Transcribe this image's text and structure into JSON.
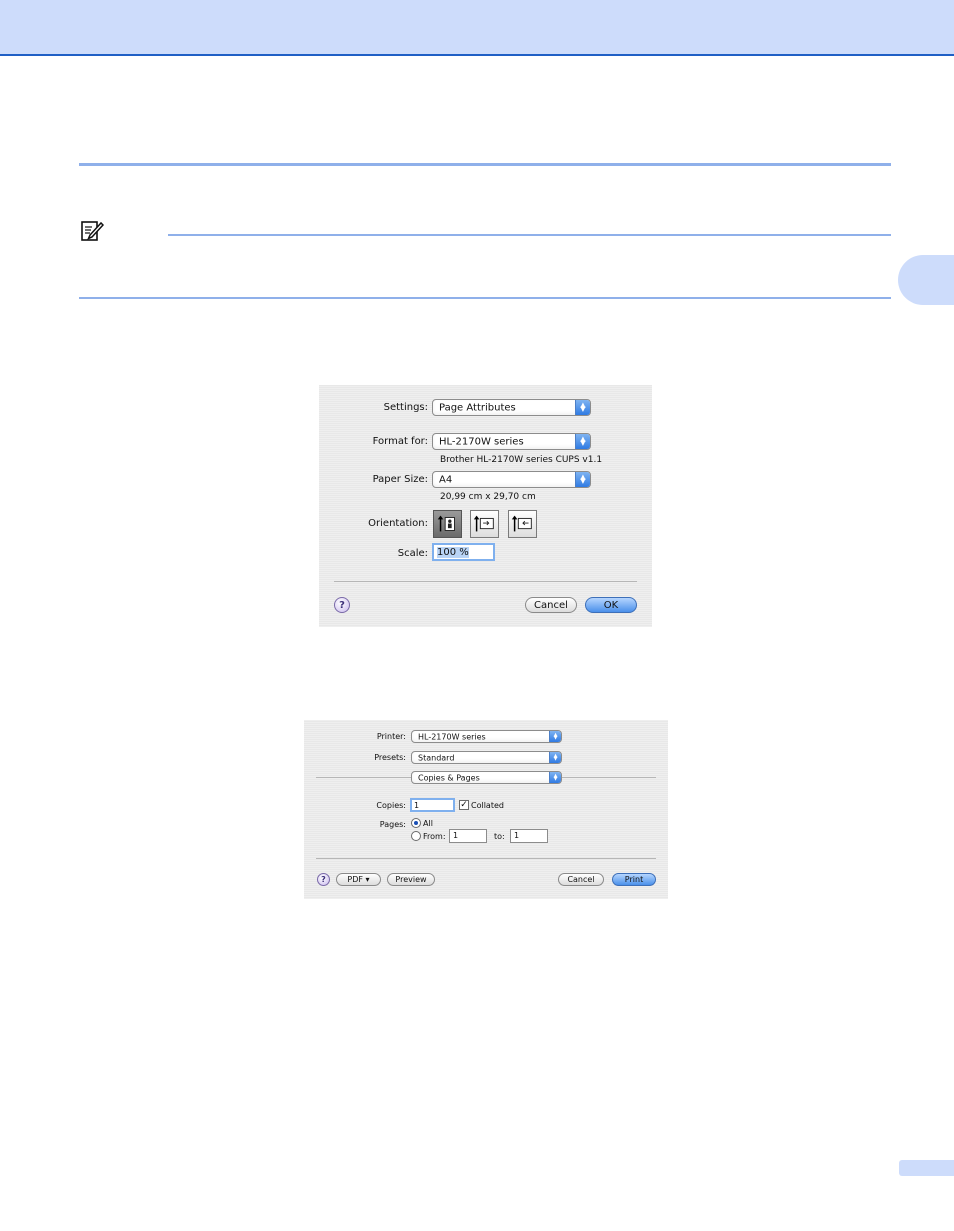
{
  "page_setup": {
    "settings_label": "Settings:",
    "settings_value": "Page Attributes",
    "format_for_label": "Format for:",
    "format_for_value": "HL-2170W series",
    "format_for_desc": "Brother HL-2170W series CUPS v1.1",
    "paper_size_label": "Paper Size:",
    "paper_size_value": "A4",
    "paper_size_desc": "20,99 cm x 29,70 cm",
    "orientation_label": "Orientation:",
    "scale_label": "Scale:",
    "scale_value": "100 %",
    "help": "?",
    "cancel_label": "Cancel",
    "ok_label": "OK"
  },
  "print_dialog": {
    "printer_label": "Printer:",
    "printer_value": "HL-2170W series",
    "presets_label": "Presets:",
    "presets_value": "Standard",
    "panel_value": "Copies & Pages",
    "copies_label": "Copies:",
    "copies_value": "1",
    "collated_label": "Collated",
    "pages_label": "Pages:",
    "all_label": "All",
    "from_label": "From:",
    "from_value": "1",
    "to_label": "to:",
    "to_value": "1",
    "help": "?",
    "pdf_label": "PDF ▾",
    "preview_label": "Preview",
    "cancel_label": "Cancel",
    "print_label": "Print"
  },
  "colors": {
    "header_bg": "#cddcfb",
    "rule": "#8fb0ea",
    "header_border": "#1f5fc5"
  },
  "icons": [
    "note-pencil-icon",
    "portrait-icon",
    "landscape-icon",
    "reverse-landscape-icon",
    "help-icon",
    "popup-arrows-icon",
    "checkbox-checked-icon",
    "radio-button-icon"
  ]
}
